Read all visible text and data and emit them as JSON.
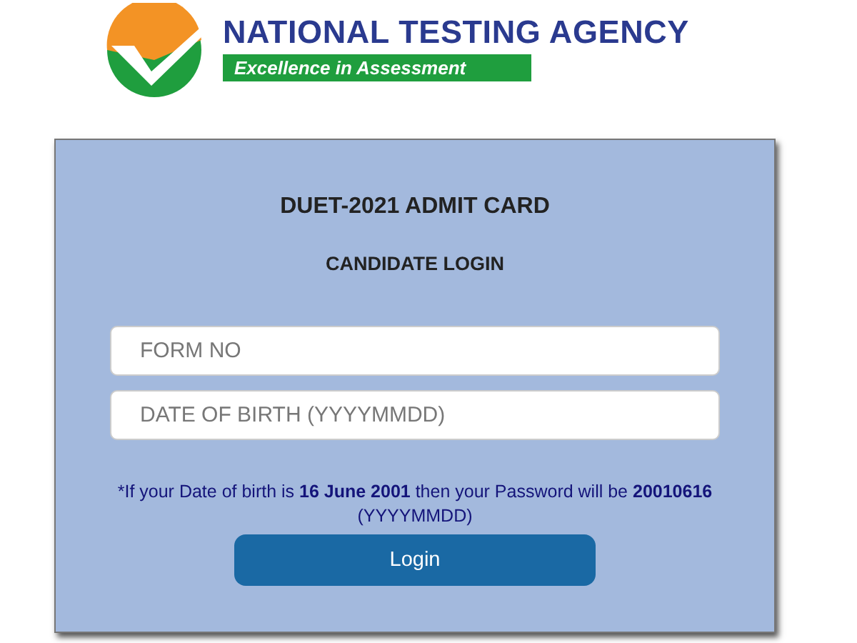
{
  "header": {
    "title": "NATIONAL TESTING AGENCY",
    "tagline": "Excellence in Assessment"
  },
  "form": {
    "heading": "DUET-2021 ADMIT CARD",
    "subheading": "CANDIDATE LOGIN",
    "fields": [
      {
        "placeholder": "FORM NO"
      },
      {
        "placeholder": "DATE OF BIRTH (YYYYMMDD)"
      }
    ],
    "note": "*If your Date of birth is **16 June 2001** then your Password will be **20010616** (YYYYMMDD)",
    "button": "Login"
  }
}
